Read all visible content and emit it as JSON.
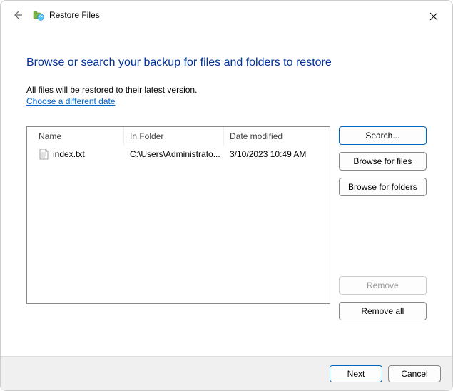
{
  "window": {
    "title": "Restore Files"
  },
  "heading": "Browse or search your backup for files and folders to restore",
  "subtext": "All files will be restored to their latest version.",
  "link": "Choose a different date",
  "columns": {
    "name": "Name",
    "folder": "In Folder",
    "date": "Date modified"
  },
  "files": [
    {
      "name": "index.txt",
      "folder": "C:\\Users\\Administrato...",
      "date": "3/10/2023 10:49 AM"
    }
  ],
  "buttons": {
    "search": "Search...",
    "browse_files": "Browse for files",
    "browse_folders": "Browse for folders",
    "remove": "Remove",
    "remove_all": "Remove all",
    "next": "Next",
    "cancel": "Cancel"
  }
}
